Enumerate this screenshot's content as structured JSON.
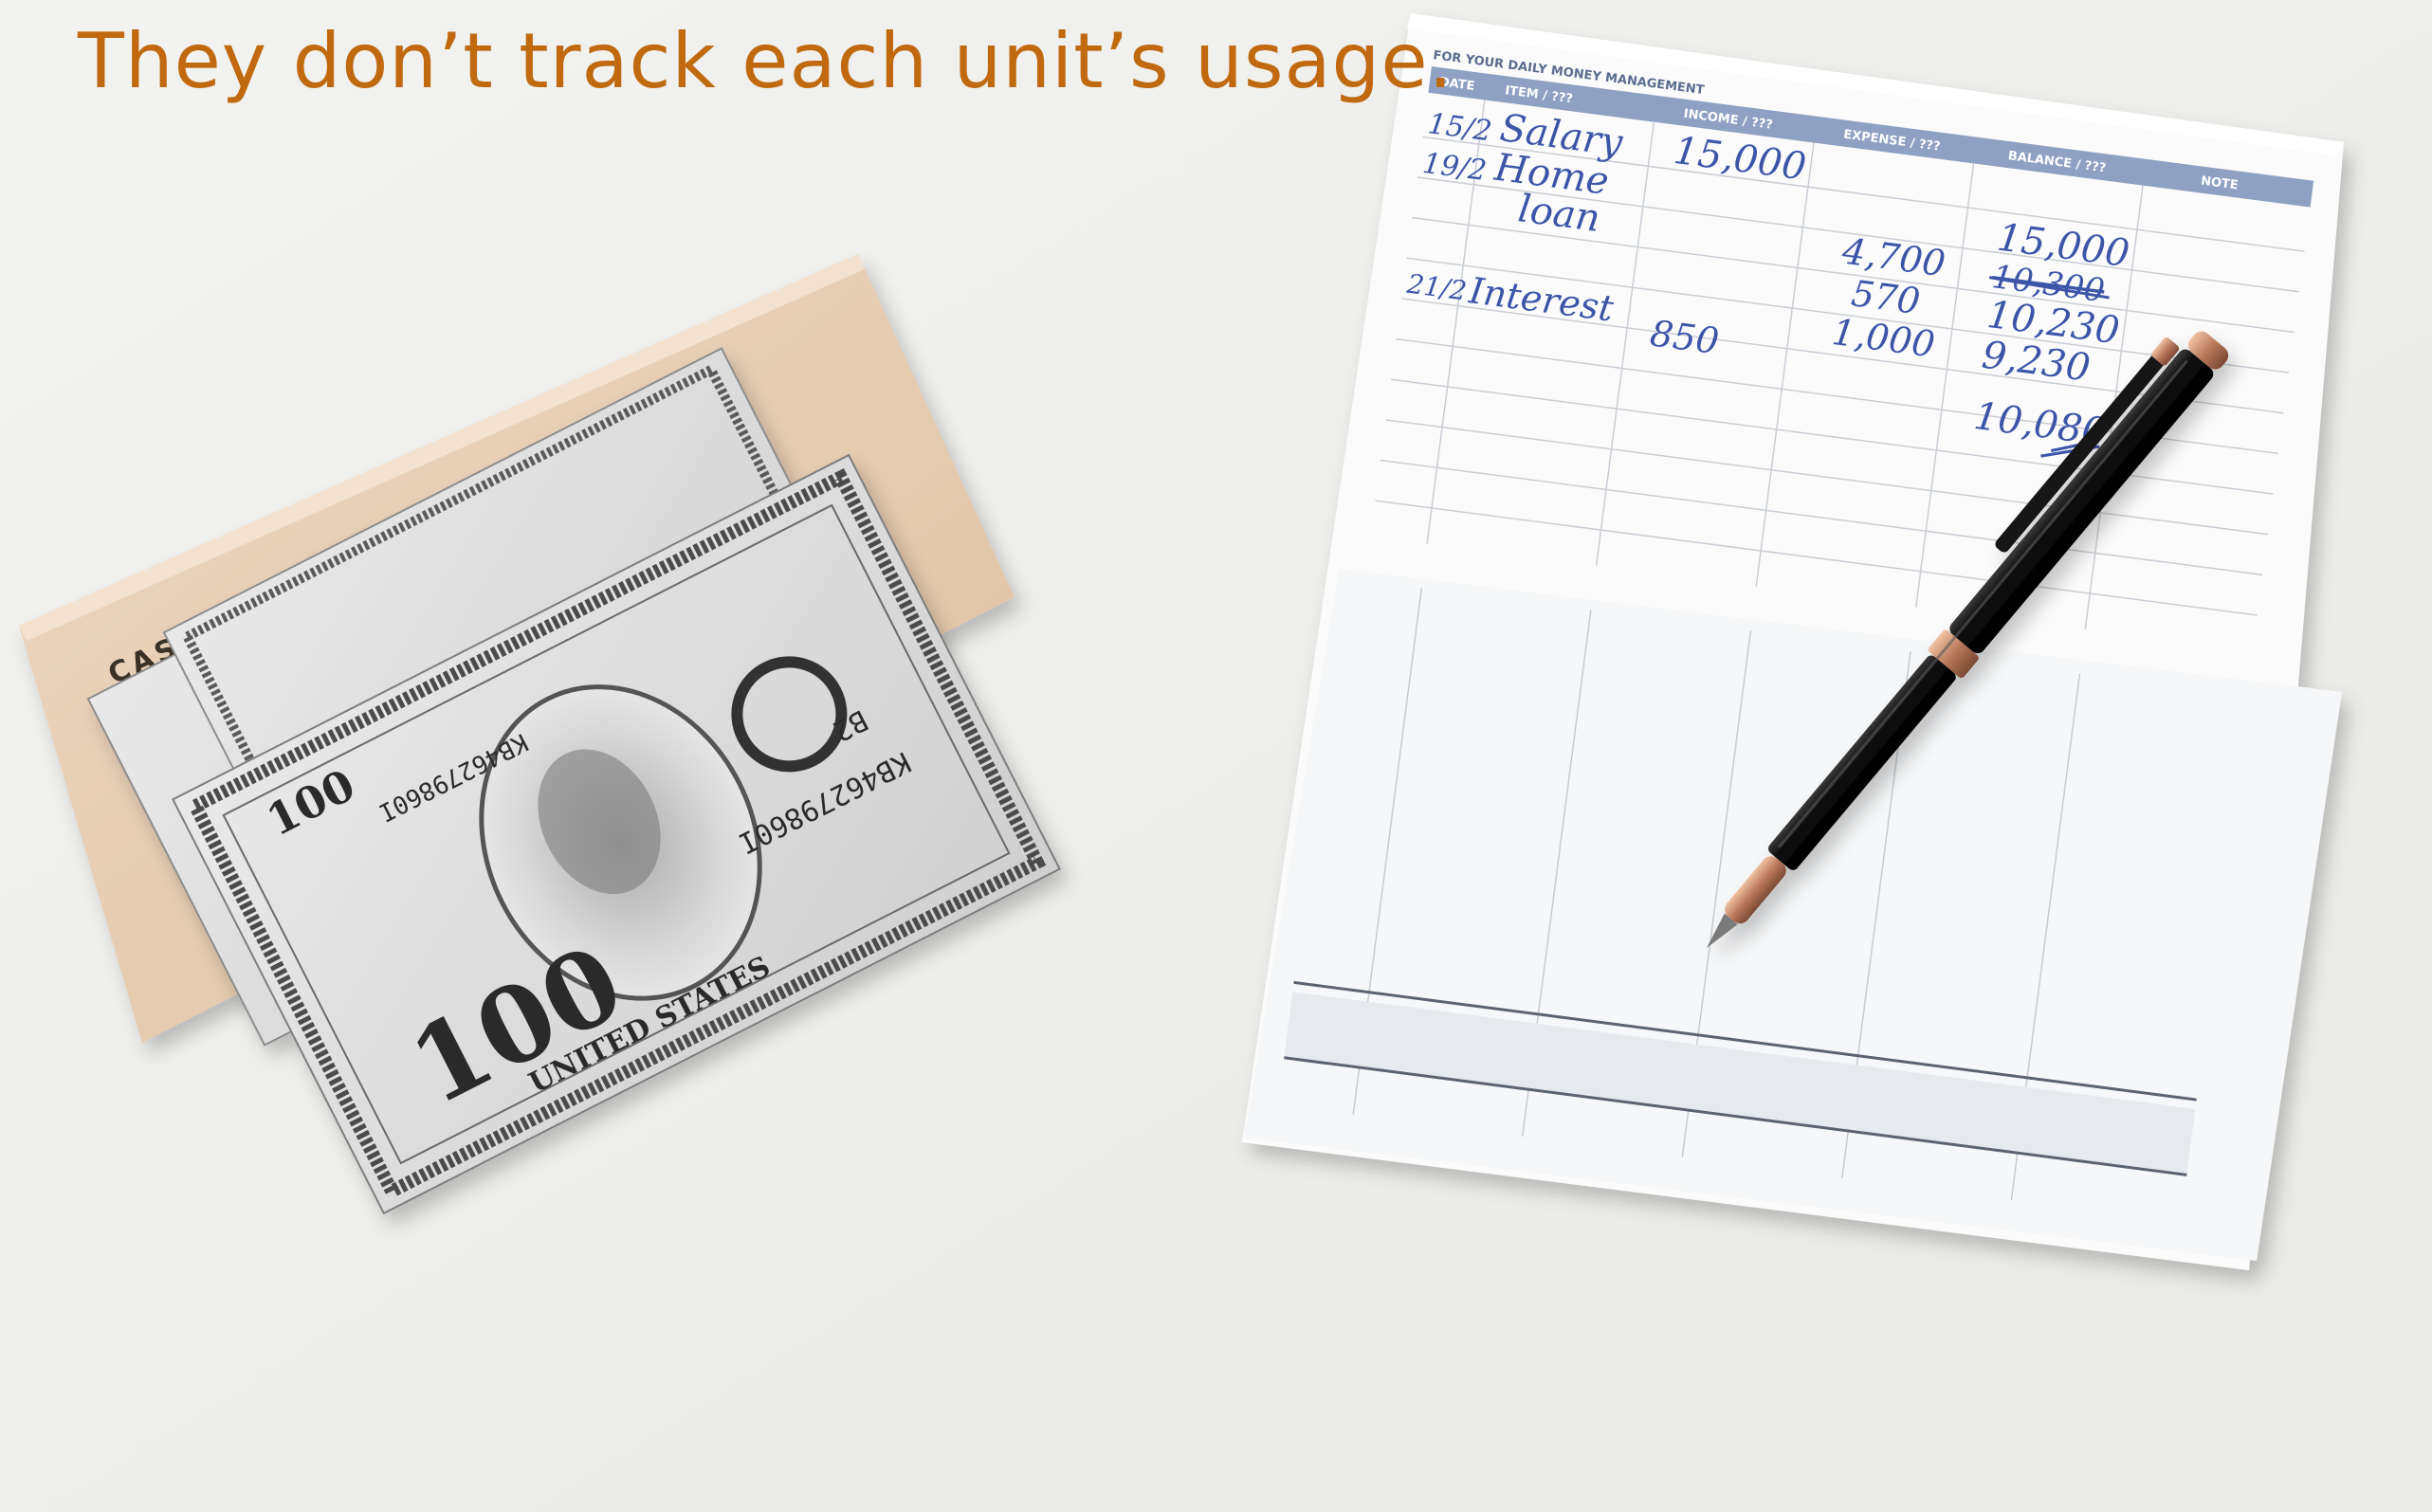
{
  "caption": "They don’t track each unit’s usage.",
  "colors": {
    "caption": "#c0690f",
    "background": "#eeeeec",
    "cashbook": "#e6cdb3",
    "ink": "#3c55a8",
    "ledger_header": "#8ea1c2"
  },
  "cashbook": {
    "label": "CASHBOOK"
  },
  "banknotes": {
    "serial": "KB46279860I",
    "serial_suffix": "B2",
    "denomination": "100",
    "country_text": "UNITED STATES"
  },
  "ledger": {
    "banner": "FOR YOUR DAILY MONEY MANAGEMENT",
    "headers": [
      "DATE",
      "ITEM / ???",
      "INCOME / ???",
      "EXPENSE / ???",
      "BALANCE / ???",
      "NOTE"
    ],
    "entries": [
      {
        "date": "15/2",
        "item": "Salary",
        "income": "15,000",
        "expense": "",
        "balance": "15,000"
      },
      {
        "date": "19/2",
        "item": "Home",
        "income": "",
        "expense": "",
        "balance": ""
      },
      {
        "date": "",
        "item": "loan",
        "income": "",
        "expense": "4,700",
        "balance": "10,300"
      },
      {
        "date": "",
        "item": "",
        "income": "",
        "expense": "570",
        "balance": "10,230"
      },
      {
        "date": "",
        "item": "",
        "income": "",
        "expense": "1,000",
        "balance": "9,230"
      },
      {
        "date": "21/2",
        "item": "Interest",
        "income": "850",
        "expense": "",
        "balance": ""
      },
      {
        "date": "",
        "item": "",
        "income": "",
        "expense": "",
        "balance": "10,080"
      }
    ]
  },
  "pen": {
    "body_color": "#111111",
    "accent_color": "#c98a6a"
  }
}
